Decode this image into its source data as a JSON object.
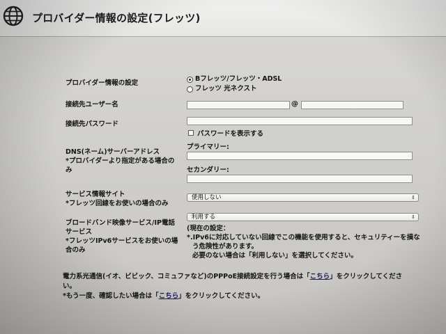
{
  "header": {
    "title": "プロバイダー情報の設定(フレッツ)",
    "icon": "globe-icon"
  },
  "provider": {
    "label": "プロバイダー情報の設定",
    "options": [
      {
        "label": "Bフレッツ/フレッツ・ADSL",
        "selected": true
      },
      {
        "label": "フレッツ 光ネクスト",
        "selected": false
      }
    ]
  },
  "username": {
    "label": "接続先ユーザー名",
    "at": "@",
    "user_value": "",
    "domain_value": ""
  },
  "password": {
    "label": "接続先パスワード",
    "value": "",
    "show_label": "パスワードを表示する",
    "show_checked": false
  },
  "dns": {
    "label": "DNS(ネーム)サーバーアドレス",
    "note_line1": "*プロバイダーより指定がある場合の",
    "note_line2": "み",
    "primary_label": "プライマリー:",
    "primary_value": "",
    "secondary_label": "セカンダリー:",
    "secondary_value": ""
  },
  "service_site": {
    "label": "サービス情報サイト",
    "note": "*フレッツ回線をお使いの場合のみ",
    "selected": "使用しない"
  },
  "broadband": {
    "label_line1": "ブロードバンド映像サービス/IP電話",
    "label_line2": "サービス",
    "note_line1": "*フレッツIPv6サービスをお使いの場",
    "note_line2": "合のみ",
    "selected": "利用する",
    "desc_line1": "(現在の設定：",
    "desc_line2": "*.IPv6に対応していない回線でこの機能を使用すると、セキュリティーを損な",
    "desc_line3": "う危険性があります。",
    "desc_line4": "必要のない場合は「利用しない」を選択してください。"
  },
  "footer": {
    "line1_pre": "電力系光通信(イオ、ビビック、コミュファなど)のPPPoE接続設定を行う場合は「",
    "line1_link": "こちら",
    "line1_post": "」をクリックしてくださ",
    "line2": "い。",
    "line3_pre": "*もう一度、確認したい場合は「",
    "line3_link": "こちら",
    "line3_post": "」をクリックしてください。"
  }
}
